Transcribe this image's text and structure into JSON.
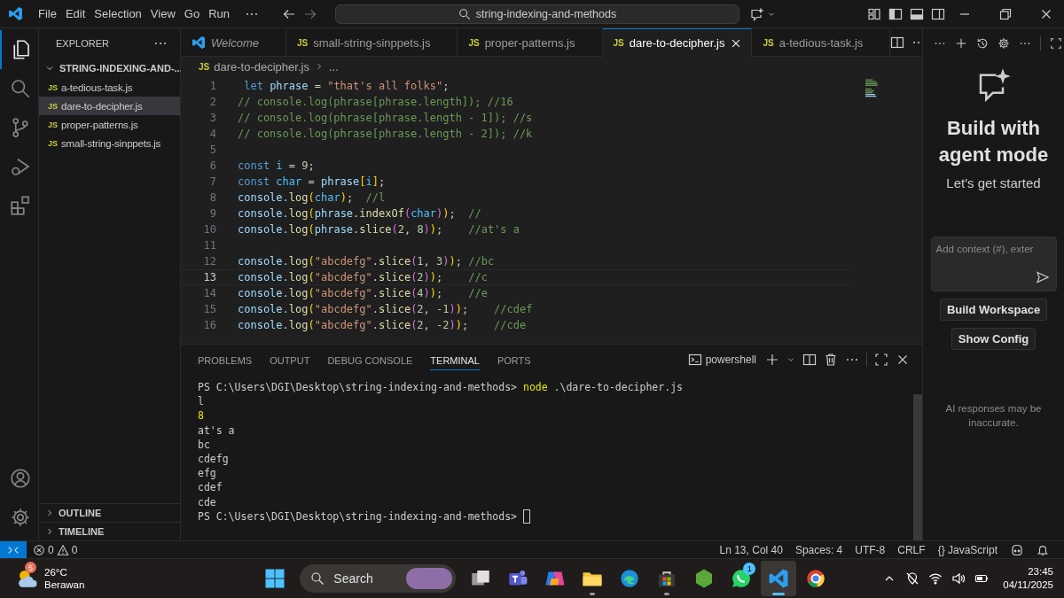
{
  "title_bar": {
    "menus": [
      "File",
      "Edit",
      "Selection",
      "View",
      "Go",
      "Run"
    ],
    "search": "string-indexing-and-methods"
  },
  "activity_bar": [
    {
      "selected": true
    },
    {
      "selected": false
    },
    {
      "selected": false
    },
    {
      "selected": false
    },
    {
      "selected": false
    }
  ],
  "sidebar": {
    "title": "EXPLORER",
    "folder": {
      "label": "STRING-INDEXING-AND-...",
      "expanded": true,
      "children": [
        {
          "badge": "JS",
          "label": "a-tedious-task.js",
          "selected": false
        },
        {
          "badge": "JS",
          "label": "dare-to-decipher.js",
          "selected": true
        },
        {
          "badge": "JS",
          "label": "proper-patterns.js",
          "selected": false
        },
        {
          "badge": "JS",
          "label": "small-string-sinppets.js",
          "selected": false
        }
      ]
    },
    "sections": [
      {
        "label": "OUTLINE",
        "expanded": false
      },
      {
        "label": "TIMELINE",
        "expanded": false
      }
    ]
  },
  "tabs": [
    {
      "kind": "welcome",
      "label": "Welcome",
      "selected": false
    },
    {
      "kind": "file",
      "badge": "JS",
      "label": "small-string-sinppets.js",
      "selected": false
    },
    {
      "kind": "file",
      "badge": "JS",
      "label": "proper-patterns.js",
      "selected": false
    },
    {
      "kind": "file",
      "badge": "JS",
      "label": "dare-to-decipher.js",
      "selected": true
    },
    {
      "kind": "file",
      "badge": "JS",
      "label": "a-tedious-task.js",
      "selected": false
    }
  ],
  "breadcrumb": {
    "badge": "JS",
    "file": "dare-to-decipher.js",
    "tail": "..."
  },
  "editor": {
    "lines": [
      {
        "number": "1",
        "current": false,
        "tokens": [
          {
            "text": " let",
            "kind": "kw"
          },
          {
            "text": " phrase",
            "kind": "var"
          },
          {
            "text": " = ",
            "kind": "p"
          },
          {
            "text": "\"that's all folks\"",
            "kind": "str"
          },
          {
            "text": ";",
            "kind": "p"
          }
        ]
      },
      {
        "number": "2",
        "current": false,
        "tokens": [
          {
            "text": "// console.log(phrase[phrase.length]); //16",
            "kind": "com"
          }
        ]
      },
      {
        "number": "3",
        "current": false,
        "tokens": [
          {
            "text": "// console.log(phrase[phrase.length - 1]); //s",
            "kind": "com"
          }
        ]
      },
      {
        "number": "4",
        "current": false,
        "tokens": [
          {
            "text": "// console.log(phrase[phrase.length - 2]); //k",
            "kind": "com"
          }
        ]
      },
      {
        "number": "5",
        "current": false
      },
      {
        "number": "6",
        "current": false,
        "tokens": [
          {
            "text": "const",
            "kind": "kw"
          },
          {
            "text": " i",
            "kind": "const"
          },
          {
            "text": " = ",
            "kind": "p"
          },
          {
            "text": "9",
            "kind": "num"
          },
          {
            "text": ";",
            "kind": "p"
          }
        ]
      },
      {
        "number": "7",
        "current": false,
        "tokens": [
          {
            "text": "const",
            "kind": "kw"
          },
          {
            "text": " char",
            "kind": "const"
          },
          {
            "text": " = ",
            "kind": "p"
          },
          {
            "text": "phrase",
            "kind": "var"
          },
          {
            "text": "[",
            "kind": "b1"
          },
          {
            "text": "i",
            "kind": "const"
          },
          {
            "text": "]",
            "kind": "b1"
          },
          {
            "text": ";",
            "kind": "p"
          }
        ]
      },
      {
        "number": "8",
        "current": false,
        "tokens": [
          {
            "text": "console",
            "kind": "var"
          },
          {
            "text": ".",
            "kind": "p"
          },
          {
            "text": "log",
            "kind": "fn"
          },
          {
            "text": "(",
            "kind": "b1"
          },
          {
            "text": "char",
            "kind": "const"
          },
          {
            "text": ")",
            "kind": "b1"
          },
          {
            "text": ";  ",
            "kind": "p"
          },
          {
            "text": "//l",
            "kind": "com"
          }
        ]
      },
      {
        "number": "9",
        "current": false,
        "tokens": [
          {
            "text": "console",
            "kind": "var"
          },
          {
            "text": ".",
            "kind": "p"
          },
          {
            "text": "log",
            "kind": "fn"
          },
          {
            "text": "(",
            "kind": "b1"
          },
          {
            "text": "phrase",
            "kind": "var"
          },
          {
            "text": ".",
            "kind": "p"
          },
          {
            "text": "indexOf",
            "kind": "fn"
          },
          {
            "text": "(",
            "kind": "b2"
          },
          {
            "text": "char",
            "kind": "const"
          },
          {
            "text": ")",
            "kind": "b2"
          },
          {
            "text": ")",
            "kind": "b1"
          },
          {
            "text": ";  ",
            "kind": "p"
          },
          {
            "text": "//",
            "kind": "com"
          }
        ]
      },
      {
        "number": "10",
        "current": false,
        "tokens": [
          {
            "text": "console",
            "kind": "var"
          },
          {
            "text": ".",
            "kind": "p"
          },
          {
            "text": "log",
            "kind": "fn"
          },
          {
            "text": "(",
            "kind": "b1"
          },
          {
            "text": "phrase",
            "kind": "var"
          },
          {
            "text": ".",
            "kind": "p"
          },
          {
            "text": "slice",
            "kind": "fn"
          },
          {
            "text": "(",
            "kind": "b2"
          },
          {
            "text": "2",
            "kind": "num"
          },
          {
            "text": ", ",
            "kind": "p"
          },
          {
            "text": "8",
            "kind": "num"
          },
          {
            "text": ")",
            "kind": "b2"
          },
          {
            "text": ")",
            "kind": "b1"
          },
          {
            "text": ";    ",
            "kind": "p"
          },
          {
            "text": "//at's a",
            "kind": "com"
          }
        ]
      },
      {
        "number": "11",
        "current": false
      },
      {
        "number": "12",
        "current": false,
        "tokens": [
          {
            "text": "console",
            "kind": "var"
          },
          {
            "text": ".",
            "kind": "p"
          },
          {
            "text": "log",
            "kind": "fn"
          },
          {
            "text": "(",
            "kind": "b1"
          },
          {
            "text": "\"abcdefg\"",
            "kind": "str"
          },
          {
            "text": ".",
            "kind": "p"
          },
          {
            "text": "slice",
            "kind": "fn"
          },
          {
            "text": "(",
            "kind": "b2"
          },
          {
            "text": "1",
            "kind": "num"
          },
          {
            "text": ", ",
            "kind": "p"
          },
          {
            "text": "3",
            "kind": "num"
          },
          {
            "text": ")",
            "kind": "b2"
          },
          {
            "text": ")",
            "kind": "b1"
          },
          {
            "text": "; ",
            "kind": "p"
          },
          {
            "text": "//bc",
            "kind": "com"
          }
        ]
      },
      {
        "number": "13",
        "current": true,
        "tokens": [
          {
            "text": "console",
            "kind": "var"
          },
          {
            "text": ".",
            "kind": "p"
          },
          {
            "text": "log",
            "kind": "fn"
          },
          {
            "text": "(",
            "kind": "b1"
          },
          {
            "text": "\"abcdefg\"",
            "kind": "str"
          },
          {
            "text": ".",
            "kind": "p"
          },
          {
            "text": "slice",
            "kind": "fn"
          },
          {
            "text": "(",
            "kind": "b2"
          },
          {
            "text": "2",
            "kind": "num"
          },
          {
            "text": ")",
            "kind": "b2"
          },
          {
            "text": ")",
            "kind": "b1"
          },
          {
            "text": ";    ",
            "kind": "p"
          },
          {
            "text": "//c",
            "kind": "com"
          }
        ]
      },
      {
        "number": "14",
        "current": false,
        "tokens": [
          {
            "text": "console",
            "kind": "var"
          },
          {
            "text": ".",
            "kind": "p"
          },
          {
            "text": "log",
            "kind": "fn"
          },
          {
            "text": "(",
            "kind": "b1"
          },
          {
            "text": "\"abcdefg\"",
            "kind": "str"
          },
          {
            "text": ".",
            "kind": "p"
          },
          {
            "text": "slice",
            "kind": "fn"
          },
          {
            "text": "(",
            "kind": "b2"
          },
          {
            "text": "4",
            "kind": "num"
          },
          {
            "text": ")",
            "kind": "b2"
          },
          {
            "text": ")",
            "kind": "b1"
          },
          {
            "text": ";    ",
            "kind": "p"
          },
          {
            "text": "//e",
            "kind": "com"
          }
        ]
      },
      {
        "number": "15",
        "current": false,
        "tokens": [
          {
            "text": "console",
            "kind": "var"
          },
          {
            "text": ".",
            "kind": "p"
          },
          {
            "text": "log",
            "kind": "fn"
          },
          {
            "text": "(",
            "kind": "b1"
          },
          {
            "text": "\"abcdefg\"",
            "kind": "str"
          },
          {
            "text": ".",
            "kind": "p"
          },
          {
            "text": "slice",
            "kind": "fn"
          },
          {
            "text": "(",
            "kind": "b2"
          },
          {
            "text": "2",
            "kind": "num"
          },
          {
            "text": ", ",
            "kind": "p"
          },
          {
            "text": "-1",
            "kind": "num"
          },
          {
            "text": ")",
            "kind": "b2"
          },
          {
            "text": ")",
            "kind": "b1"
          },
          {
            "text": ";    ",
            "kind": "p"
          },
          {
            "text": "//cdef",
            "kind": "com"
          }
        ]
      },
      {
        "number": "16",
        "current": false,
        "tokens": [
          {
            "text": "console",
            "kind": "var"
          },
          {
            "text": ".",
            "kind": "p"
          },
          {
            "text": "log",
            "kind": "fn"
          },
          {
            "text": "(",
            "kind": "b1"
          },
          {
            "text": "\"abcdefg\"",
            "kind": "str"
          },
          {
            "text": ".",
            "kind": "p"
          },
          {
            "text": "slice",
            "kind": "fn"
          },
          {
            "text": "(",
            "kind": "b2"
          },
          {
            "text": "2",
            "kind": "num"
          },
          {
            "text": ", ",
            "kind": "p"
          },
          {
            "text": "-2",
            "kind": "num"
          },
          {
            "text": ")",
            "kind": "b2"
          },
          {
            "text": ")",
            "kind": "b1"
          },
          {
            "text": ";    ",
            "kind": "p"
          },
          {
            "text": "//cde",
            "kind": "com"
          }
        ]
      }
    ]
  },
  "panel": {
    "tabs": [
      {
        "label": "PROBLEMS",
        "selected": false
      },
      {
        "label": "OUTPUT",
        "selected": false
      },
      {
        "label": "DEBUG CONSOLE",
        "selected": false
      },
      {
        "label": "TERMINAL",
        "selected": true
      },
      {
        "label": "PORTS",
        "selected": false
      }
    ],
    "shell": "powershell",
    "cursor": true,
    "terminal": [
      {
        "tokens": [
          {
            "text": "PS C:\\Users\\DGI\\Desktop\\string-indexing-and-methods> ",
            "kind": "plain"
          },
          {
            "text": "node",
            "kind": "cmd"
          },
          {
            "text": " .\\dare-to-decipher.js",
            "kind": "plain"
          }
        ]
      },
      {
        "tokens": [
          {
            "text": "l",
            "kind": "plain"
          }
        ]
      },
      {
        "tokens": [
          {
            "text": "8",
            "kind": "num"
          }
        ]
      },
      {
        "tokens": [
          {
            "text": "at's a",
            "kind": "plain"
          }
        ]
      },
      {
        "tokens": [
          {
            "text": "bc",
            "kind": "plain"
          }
        ]
      },
      {
        "tokens": [
          {
            "text": "cdefg",
            "kind": "plain"
          }
        ]
      },
      {
        "tokens": [
          {
            "text": "efg",
            "kind": "plain"
          }
        ]
      },
      {
        "tokens": [
          {
            "text": "cdef",
            "kind": "plain"
          }
        ]
      },
      {
        "tokens": [
          {
            "text": "cde",
            "kind": "plain"
          }
        ]
      },
      {
        "tokens": [
          {
            "text": "PS C:\\Users\\DGI\\Desktop\\string-indexing-and-methods> ",
            "kind": "plain"
          }
        ]
      }
    ]
  },
  "chat": {
    "title": "Build with agent mode",
    "subtitle": "Let's get started",
    "placeholder": "Add context (#), exter",
    "buttons": [
      "Build Workspace",
      "Show Config"
    ],
    "note": "AI responses may be inaccurate."
  },
  "status_bar": {
    "errors": "0",
    "warnings": "0",
    "items": [
      "Ln 13, Col 40",
      "Spaces: 4",
      "UTF-8",
      "CRLF"
    ],
    "language": {
      "glyph": "{}",
      "label": "JavaScript"
    }
  },
  "taskbar": {
    "weather": {
      "badge": "5",
      "temperature": "26°C",
      "condition": "Berawan"
    },
    "search": "Search",
    "apps": [
      {
        "running": false,
        "active": false
      },
      {
        "running": false,
        "active": false
      },
      {
        "running": false,
        "active": false
      },
      {
        "running": true,
        "active": false
      },
      {
        "running": false,
        "active": false
      },
      {
        "running": true,
        "active": false
      },
      {
        "running": false,
        "active": false
      },
      {
        "running": false,
        "active": false,
        "badge": "1"
      },
      {
        "running": true,
        "active": true
      },
      {
        "running": false,
        "active": false
      }
    ],
    "clock": {
      "time": "23:45",
      "date": "04/11/2025"
    }
  }
}
